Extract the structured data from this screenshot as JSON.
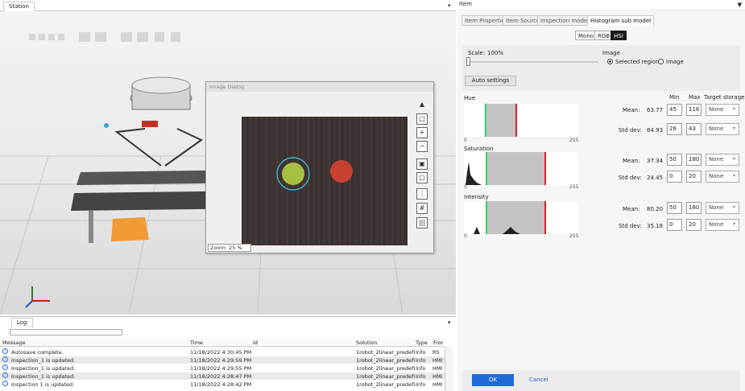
{
  "station": {
    "tab_label": "Station",
    "pin": "▾"
  },
  "dialog": {
    "title": "Image Dialog",
    "zoom": "Zoom: 25 %",
    "tools": [
      "pointer-icon",
      "select-icon",
      "zoom-in-icon",
      "zoom-out-icon",
      "image-icon",
      "fit-icon",
      "crop-icon",
      "grid-icon",
      "barcode-icon"
    ]
  },
  "log": {
    "tab_label": "Log",
    "pin": "▾",
    "columns": {
      "message": "Message",
      "time": "Time",
      "id": "Id",
      "solution": "Solution",
      "type": "Type",
      "from": "Fror"
    },
    "rows": [
      {
        "message": "Autosave complete.",
        "time": "11/18/2022 4:30:45 PM",
        "solution": "1robot_2linear_predefi",
        "type": "Info",
        "from": "RS"
      },
      {
        "message": "Inspection_1 is updated.",
        "time": "11/18/2022 4:29:59 PM",
        "solution": "1robot_2linear_predefi",
        "type": "Info",
        "from": "HMI"
      },
      {
        "message": "Inspection_1 is updated.",
        "time": "11/18/2022 4:29:55 PM",
        "solution": "1robot_2linear_predefi",
        "type": "Info",
        "from": "HMI"
      },
      {
        "message": "Inspection_1 is updated.",
        "time": "11/18/2022 4:28:47 PM",
        "solution": "1robot_2linear_predefi",
        "type": "Info",
        "from": "HMI"
      },
      {
        "message": "Inspection 1 is updated.",
        "time": "11/18/2022 4:28:42 PM",
        "solution": "1robot_2linear_predefi",
        "type": "Info",
        "from": "HMI"
      }
    ]
  },
  "item": {
    "title": "Item",
    "tabs": [
      "Item Properties",
      "Item Source",
      "Inspection model",
      "Histogram sub model"
    ],
    "modes": [
      "Mono",
      "RGB",
      "HSI"
    ],
    "scale_label": "Scale:",
    "scale_value": "100%",
    "image_label": "Image",
    "radio_selected": "Selected region",
    "radio_image": "Image",
    "auto_settings": "Auto settings",
    "col_min": "Min",
    "col_max": "Max",
    "col_target": "Target storage",
    "mean_label": "Mean:",
    "std_label": "Std dev:",
    "tick_min": "0",
    "tick_max": "255",
    "channels": [
      {
        "name": "Hue",
        "mean": "63.77",
        "min": "45",
        "max": "116",
        "std": "64.93",
        "std_min": "26",
        "std_max": "43",
        "target": "None",
        "target2": "None",
        "green": 0.18,
        "red": 0.45
      },
      {
        "name": "Saturation",
        "mean": "37.34",
        "min": "50",
        "max": "180",
        "std": "24.45",
        "std_min": "0",
        "std_max": "20",
        "target": "None",
        "target2": "None",
        "green": 0.2,
        "red": 0.71
      },
      {
        "name": "Intensity",
        "mean": "80.20",
        "min": "50",
        "max": "180",
        "std": "35.18",
        "std_min": "0",
        "std_max": "20",
        "target": "None",
        "target2": "None",
        "green": 0.2,
        "red": 0.71
      }
    ],
    "ok": "OK",
    "cancel": "Cancel"
  },
  "colors": {
    "accent": "#1e6ad6",
    "green_marker": "#22dd66",
    "red_marker": "#dd2222"
  }
}
